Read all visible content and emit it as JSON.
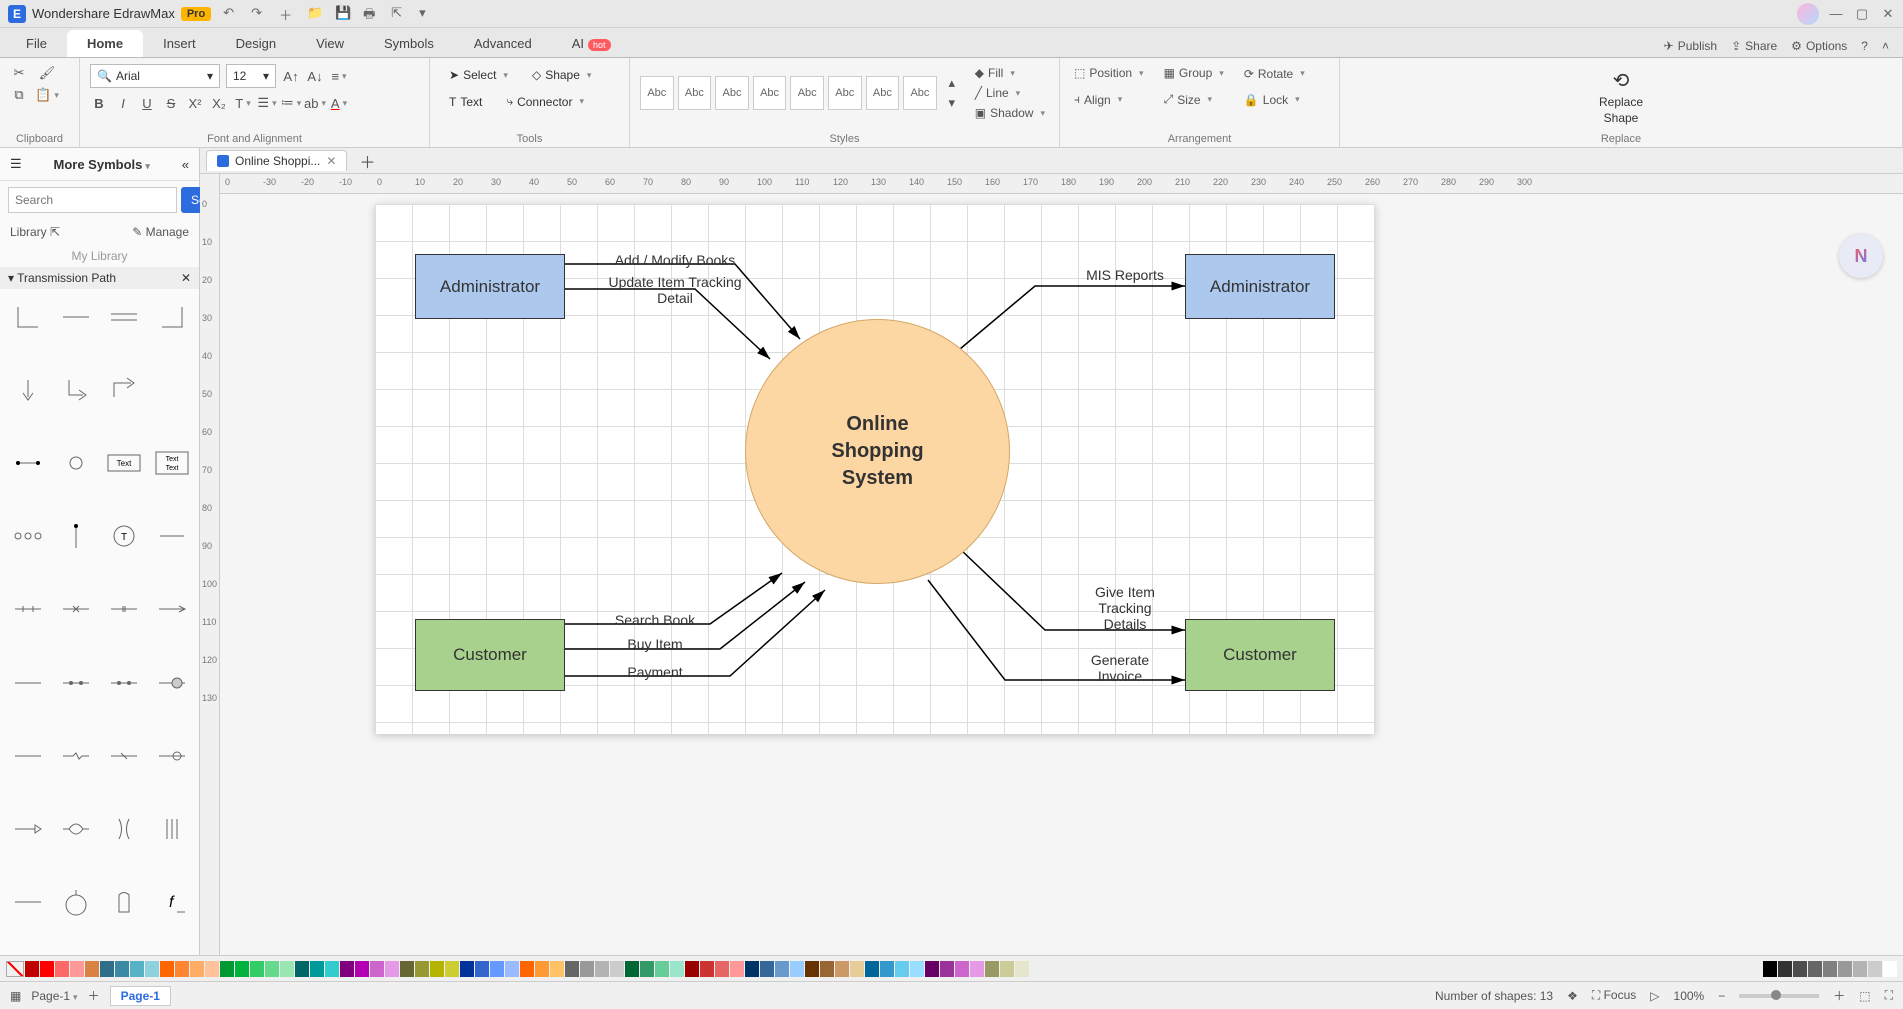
{
  "app": {
    "title": "Wondershare EdrawMax",
    "pro_badge": "Pro"
  },
  "menus": {
    "file": "File",
    "home": "Home",
    "insert": "Insert",
    "design": "Design",
    "view": "View",
    "symbols": "Symbols",
    "advanced": "Advanced",
    "ai": "AI",
    "ai_hot": "hot"
  },
  "top_right": {
    "publish": "Publish",
    "share": "Share",
    "options": "Options"
  },
  "ribbon": {
    "clipboard": "Clipboard",
    "font_alignment": "Font and Alignment",
    "font_name": "Arial",
    "font_size": "12",
    "tools": "Tools",
    "select": "Select",
    "text": "Text",
    "shape": "Shape",
    "connector": "Connector",
    "styles": "Styles",
    "style_label": "Abc",
    "fill": "Fill",
    "line": "Line",
    "shadow": "Shadow",
    "arrangement": "Arrangement",
    "position": "Position",
    "align": "Align",
    "group": "Group",
    "size": "Size",
    "rotate": "Rotate",
    "lock": "Lock",
    "replace": "Replace",
    "replace_shape_l1": "Replace",
    "replace_shape_l2": "Shape"
  },
  "left_panel": {
    "title": "More Symbols",
    "search_placeholder": "Search",
    "search_btn": "Search",
    "library": "Library",
    "manage": "Manage",
    "my_library": "My Library",
    "category": "Transmission Path"
  },
  "doc_tab": "Online Shoppi...",
  "ruler_h": [
    "0",
    "-30",
    "-20",
    "-10",
    "0",
    "10",
    "20",
    "30",
    "40",
    "50",
    "60",
    "70",
    "80",
    "90",
    "100",
    "110",
    "120",
    "130",
    "140",
    "150",
    "160",
    "170",
    "180",
    "190",
    "200",
    "210",
    "220",
    "230",
    "240",
    "250",
    "260",
    "270",
    "280",
    "290",
    "300"
  ],
  "ruler_v": [
    "0",
    "10",
    "20",
    "30",
    "40",
    "50",
    "60",
    "70",
    "80",
    "90",
    "100",
    "110",
    "120",
    "130"
  ],
  "diagram": {
    "admin1": "Administrator",
    "admin2": "Administrator",
    "cust1": "Customer",
    "cust2": "Customer",
    "center_l1": "Online",
    "center_l2": "Shopping",
    "center_l3": "System",
    "lbl_add_modify": "Add / Modify Books",
    "lbl_update_track_l1": "Update Item Tracking",
    "lbl_update_track_l2": "Detail",
    "lbl_mis": "MIS Reports",
    "lbl_search": "Search Book",
    "lbl_buy": "Buy Item",
    "lbl_payment": "Payment",
    "lbl_give_l1": "Give Item",
    "lbl_give_l2": "Tracking",
    "lbl_give_l3": "Details",
    "lbl_invoice_l1": "Generate",
    "lbl_invoice_l2": "Invoice"
  },
  "colorbar": [
    "#c00000",
    "#ff0000",
    "#ff6666",
    "#ff9999",
    "#d98244",
    "#2f6e88",
    "#3b8aa3",
    "#58b2c6",
    "#8dd0de",
    "#ff6600",
    "#ff8533",
    "#ffad66",
    "#ffc299",
    "#009933",
    "#00b33c",
    "#33cc66",
    "#66d98c",
    "#99e6b3",
    "#006666",
    "#009999",
    "#33cccc",
    "#800080",
    "#b300b3",
    "#cc66cc",
    "#e699e6",
    "#666633",
    "#999933",
    "#b3b300",
    "#cccc33",
    "#003399",
    "#3366cc",
    "#6699ff",
    "#99bbff",
    "#ff6600",
    "#ff9933",
    "#ffc266",
    "#666666",
    "#999999",
    "#b3b3b3",
    "#cccccc",
    "#006633",
    "#339966",
    "#66cc99",
    "#99e6cc",
    "#990000",
    "#cc3333",
    "#e66666",
    "#ff9999",
    "#003366",
    "#336699",
    "#6699cc",
    "#99ccff",
    "#663300",
    "#996633",
    "#cc9966",
    "#e6cc99",
    "#006699",
    "#3399cc",
    "#66ccee",
    "#99ddff",
    "#660066",
    "#993399",
    "#cc66cc",
    "#e699e6",
    "#999966",
    "#cccc99",
    "#e6e6cc"
  ],
  "colorbar_end": [
    "#000000",
    "#333333",
    "#4d4d4d",
    "#666666",
    "#808080",
    "#999999",
    "#b3b3b3",
    "#cccccc",
    "#ffffff"
  ],
  "status": {
    "page_dropdown": "Page-1",
    "page_tab": "Page-1",
    "shapes": "Number of shapes: 13",
    "focus": "Focus",
    "zoom": "100%"
  }
}
